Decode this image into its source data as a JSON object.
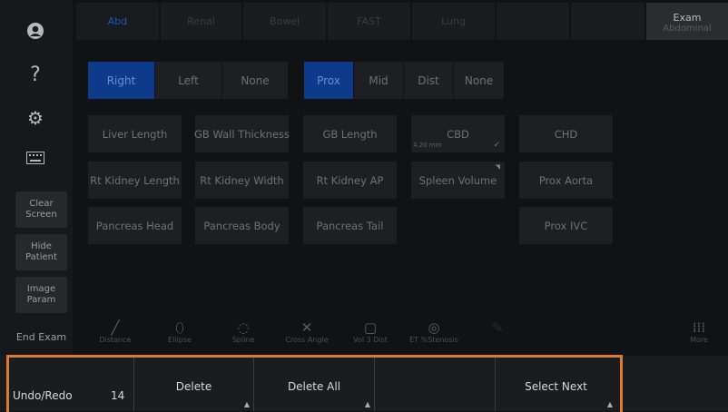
{
  "tabs": [
    "Abd",
    "Renal",
    "Bowel",
    "FAST",
    "Lung",
    "",
    "",
    ""
  ],
  "exam": {
    "label": "Exam",
    "sub": "Abdominal"
  },
  "sidebar": {
    "help_glyph": "?",
    "clear_screen": "Clear\nScreen",
    "hide_patient": "Hide\nPatient",
    "image_param": "Image\nParam",
    "end_exam": "End Exam"
  },
  "side_seg": [
    "Right",
    "Left",
    "None"
  ],
  "pos_seg": [
    "Prox",
    "Mid",
    "Dist",
    "None"
  ],
  "measurements": {
    "liver_length": "Liver Length",
    "gb_wall": "GB Wall Thickness",
    "gb_length": "GB Length",
    "cbd": "CBD",
    "cbd_value": "4.20 mm",
    "chd": "CHD",
    "rt_kidney_length": "Rt  Kidney Length",
    "rt_kidney_width": "Rt  Kidney Width",
    "rt_kidney_ap": "Rt  Kidney AP",
    "spleen_volume": "Spleen Volume",
    "prox_aorta": "Prox Aorta",
    "pancreas_head": "Pancreas Head",
    "pancreas_body": "Pancreas Body",
    "pancreas_tail": "Pancreas Tail",
    "prox_ivc": "Prox IVC"
  },
  "tools": {
    "distance": "Distance",
    "ellipse": "Ellipse",
    "spline": "Spline",
    "cross_angle": "Cross Angle",
    "vol3dist": "Vol 3 Dist",
    "et_stenosis": "ET %Stenosis",
    "more": "More"
  },
  "bottom": {
    "undo_redo": "Undo/Redo",
    "count": "14",
    "delete": "Delete",
    "delete_all": "Delete All",
    "select_next": "Select Next"
  },
  "colors": {
    "accent": "#0d3a8a",
    "highlight": "#e07a2b"
  }
}
